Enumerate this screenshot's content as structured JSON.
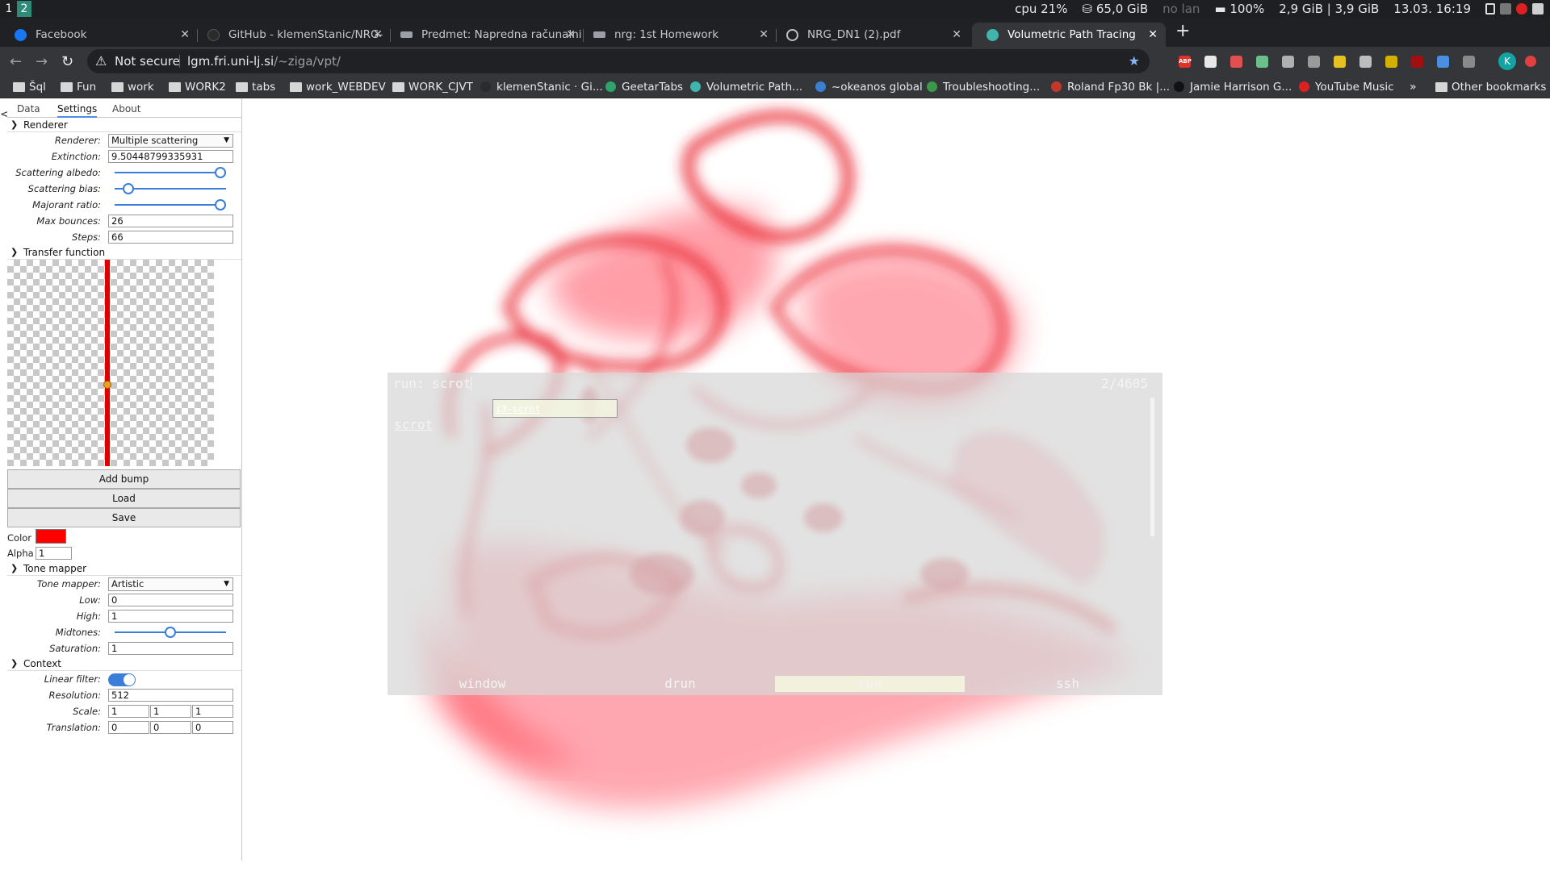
{
  "i3bar": {
    "workspaces": [
      "1",
      "2"
    ],
    "cpu_label": "cpu",
    "cpu_value": "21%",
    "disk": "65,0 GiB",
    "network": "no lan",
    "battery": "100%",
    "memory": "2,9 GiB | 3,9 GiB",
    "datetime": "13.03. 16:19"
  },
  "tabs": [
    {
      "title": "Facebook",
      "icon_color": "#1877f2"
    },
    {
      "title": "GitHub - klemenStanic/NRG-",
      "icon_color": "#2b2b2b"
    },
    {
      "title": "Predmet: Napredna računalni",
      "icon_color": "#9aa0a6"
    },
    {
      "title": "nrg: 1st Homework",
      "icon_color": "#9aa0a6"
    },
    {
      "title": "NRG_DN1 (2).pdf",
      "icon_color": "#bdc1c6"
    },
    {
      "title": "Volumetric Path Tracing",
      "icon_color": "#3fb5ad"
    }
  ],
  "tab_close": "✕",
  "new_tab": "+",
  "toolbar": {
    "back": "←",
    "forward": "→",
    "reload": "↻",
    "security_icon": "⚠",
    "security_text": "Not secure",
    "url_host": "lgm.fri.uni-lj.si",
    "url_path": "/~ziga/vpt/",
    "star": "★"
  },
  "extensions": [
    {
      "name": "adblock-plus-icon",
      "color": "#e0312b",
      "label": "ABP"
    },
    {
      "name": "extension-icon-2",
      "color": "#e8e8e8"
    },
    {
      "name": "extension-icon-3",
      "color": "#e05050"
    },
    {
      "name": "extension-icon-4",
      "color": "#6abf8a"
    },
    {
      "name": "extension-icon-5",
      "color": "#b0b0b0"
    },
    {
      "name": "extension-icon-6",
      "color": "#9a9a9a"
    },
    {
      "name": "extension-icon-7",
      "color": "#e6c020"
    },
    {
      "name": "extension-icon-8",
      "color": "#bdbdbd"
    },
    {
      "name": "extension-icon-9",
      "color": "#d4b000"
    },
    {
      "name": "ublock-icon",
      "color": "#a01010"
    },
    {
      "name": "extension-icon-11",
      "color": "#4a8fe0"
    },
    {
      "name": "extension-icon-12",
      "color": "#8a8a8a"
    }
  ],
  "profile_initial": "K",
  "bookmarks": [
    {
      "label": "Šql",
      "type": "folder"
    },
    {
      "label": "Fun",
      "type": "folder"
    },
    {
      "label": "work",
      "type": "folder"
    },
    {
      "label": "WORK2",
      "type": "folder"
    },
    {
      "label": "tabs",
      "type": "folder"
    },
    {
      "label": "work_WEBDEV",
      "type": "folder"
    },
    {
      "label": "WORK_CJVT",
      "type": "folder"
    },
    {
      "label": "klemenStanic · Gi...",
      "type": "site",
      "color": "#2b2b2b"
    },
    {
      "label": "GeetarTabs",
      "type": "site",
      "color": "#2fa36b"
    },
    {
      "label": "Volumetric Path...",
      "type": "site",
      "color": "#3fb5ad"
    },
    {
      "label": "~okeanos global",
      "type": "site",
      "color": "#3a7fd0"
    },
    {
      "label": "Troubleshooting...",
      "type": "site",
      "color": "#3a9a4a"
    },
    {
      "label": "Roland Fp30 Bk |...",
      "type": "site",
      "color": "#c0392b"
    },
    {
      "label": "Jamie Harrison G...",
      "type": "site",
      "color": "#111111"
    },
    {
      "label": "YouTube Music",
      "type": "site",
      "color": "#e02020"
    }
  ],
  "bookmarks_overflow": "»",
  "other_bookmarks": "Other bookmarks",
  "panel": {
    "collapse": "<",
    "tabs": [
      "Data",
      "Settings",
      "About"
    ],
    "renderer_section": "Renderer",
    "renderer_label": "Renderer:",
    "renderer_value": "Multiple scattering",
    "extinction_label": "Extinction:",
    "extinction_value": "9.50448799335931",
    "albedo_label": "Scattering albedo:",
    "albedo_value": 1.0,
    "bias_label": "Scattering bias:",
    "bias_value": 0.08,
    "majorant_label": "Majorant ratio:",
    "majorant_value": 1.0,
    "bounces_label": "Max bounces:",
    "bounces_value": "26",
    "steps_label": "Steps:",
    "steps_value": "66",
    "tf_section": "Transfer function",
    "add_bump": "Add bump",
    "load": "Load",
    "save": "Save",
    "color_label": "Color",
    "color_value": "#ff0000",
    "alpha_label": "Alpha",
    "alpha_value": "1",
    "tone_section": "Tone mapper",
    "tone_label": "Tone mapper:",
    "tone_value": "Artistic",
    "low_label": "Low:",
    "low_value": "0",
    "high_label": "High:",
    "high_value": "1",
    "midtones_label": "Midtones:",
    "midtones_value": 0.5,
    "saturation_label": "Saturation:",
    "saturation_value": "1",
    "context_section": "Context",
    "linear_label": "Linear filter:",
    "linear_on": true,
    "resolution_label": "Resolution:",
    "resolution_value": "512",
    "scale_label": "Scale:",
    "scale_values": [
      "1",
      "1",
      "1"
    ],
    "translation_label": "Translation:",
    "translation_values": [
      "0",
      "0",
      "0"
    ]
  },
  "rofi": {
    "prompt": "run: scrot",
    "count": "2/4605",
    "items": [
      "i3-scrot",
      "scrot"
    ],
    "modes": [
      "window",
      "drun",
      "run",
      "ssh"
    ],
    "active_mode": "run"
  }
}
